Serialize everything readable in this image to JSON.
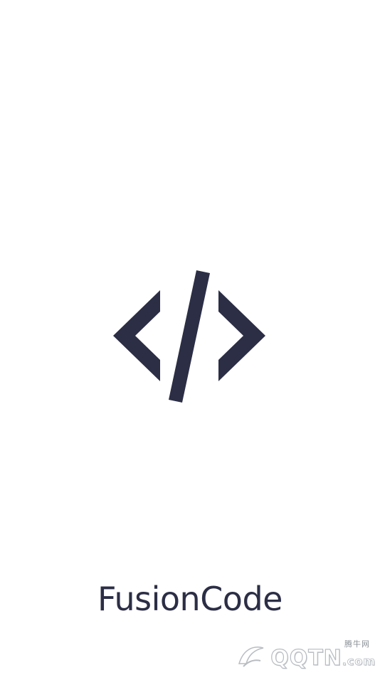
{
  "app": {
    "name": "FusionCode"
  },
  "logo": {
    "icon": "code-brackets-icon",
    "color": "#2b2e45"
  },
  "watermark": {
    "site_name": "腾牛网",
    "brand": "QQTN",
    "suffix": ".com"
  },
  "colors": {
    "background": "#ffffff",
    "text": "#2b2e45"
  }
}
